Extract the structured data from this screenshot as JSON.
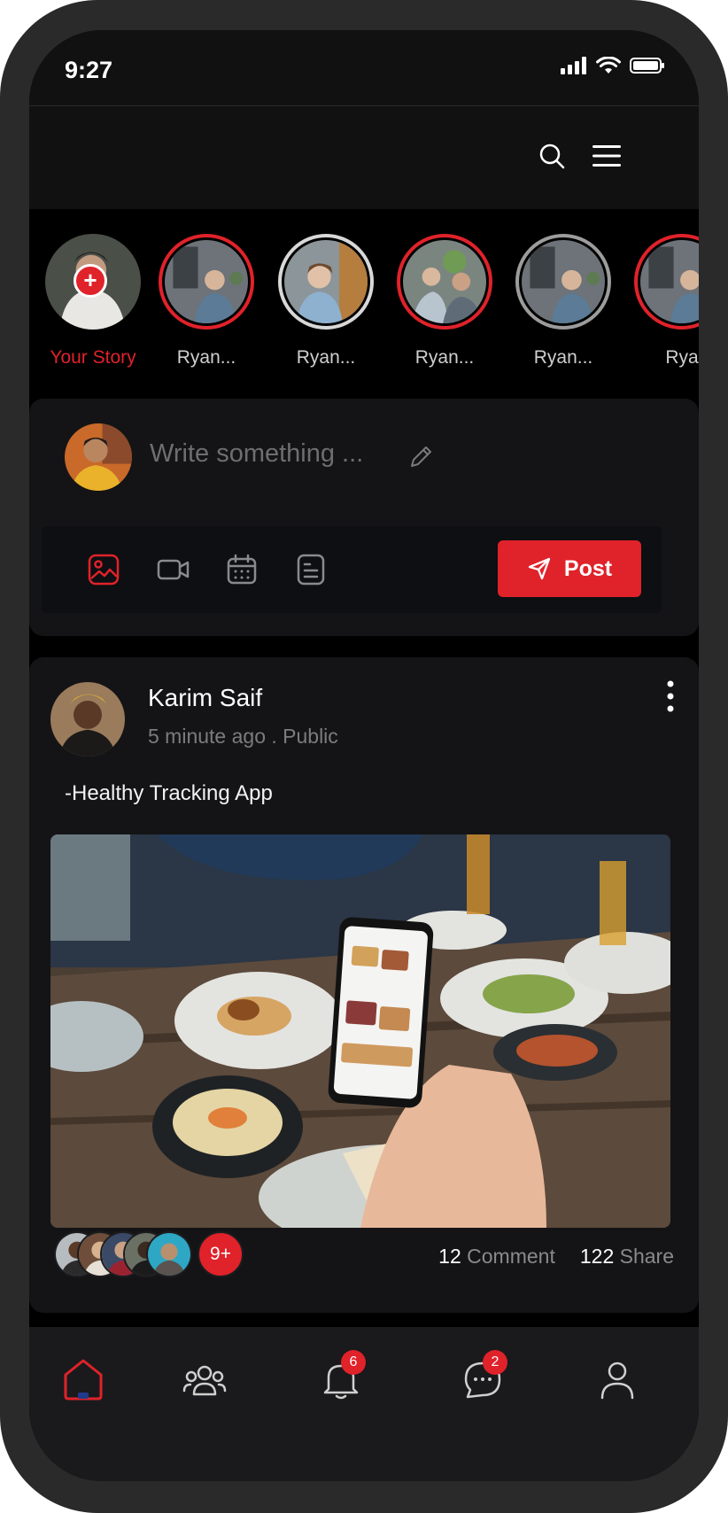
{
  "status_bar": {
    "time": "9:27"
  },
  "toolbar": {
    "search_icon": "search-icon",
    "menu_icon": "hamburger-menu-icon"
  },
  "stories": [
    {
      "name": "Your Story",
      "ring": "none"
    },
    {
      "name": "Ryan...",
      "ring": "red"
    },
    {
      "name": "Ryan...",
      "ring": "white"
    },
    {
      "name": "Ryan...",
      "ring": "red"
    },
    {
      "name": "Ryan...",
      "ring": "grey"
    },
    {
      "name": "Rya",
      "ring": "red"
    }
  ],
  "composer": {
    "placeholder": "Write something ...",
    "post_label": "Post"
  },
  "post": {
    "author": "Karim Saif",
    "meta": "5 minute ago . Public",
    "caption": "-Healthy Tracking App",
    "more_reactors": "9+",
    "comments_count": "12",
    "comments_label": "Comment",
    "shares_count": "122",
    "shares_label": "Share"
  },
  "bottom_nav": {
    "notifications_badge": "6",
    "messages_badge": "2"
  },
  "colors": {
    "accent": "#e0222a",
    "card": "#141416",
    "background": "#000000"
  }
}
